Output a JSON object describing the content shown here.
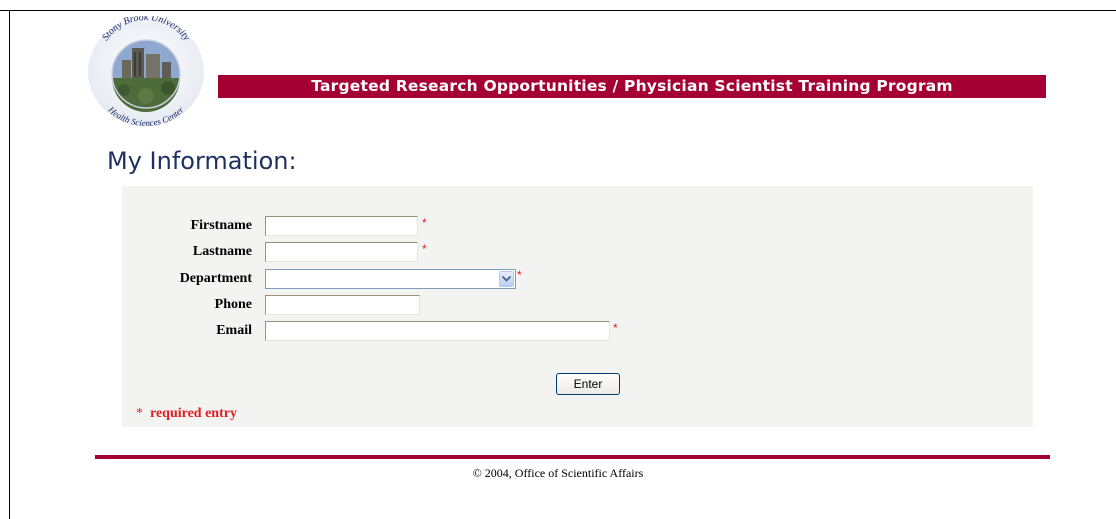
{
  "header": {
    "logo": {
      "top_text": "Stony Brook University",
      "bottom_text": "Health Sciences Center"
    },
    "banner_title": "Targeted Research Opportunities / Physician Scientist Training Program"
  },
  "page_title": "My Information:",
  "form": {
    "fields": [
      {
        "label": "Firstname",
        "value": "",
        "required": true
      },
      {
        "label": "Lastname",
        "value": "",
        "required": true
      },
      {
        "label": "Department",
        "value": "",
        "required": true
      },
      {
        "label": "Phone",
        "value": "",
        "required": false
      },
      {
        "label": "Email",
        "value": "",
        "required": true
      }
    ],
    "required_marker": "*",
    "submit_label": "Enter",
    "required_note": "required entry"
  },
  "footer": {
    "text": "© 2004, Office of Scientific Affairs"
  },
  "colors": {
    "brand": "#a50034",
    "title": "#1f2f5f",
    "required": "#e02020",
    "panel_bg": "#f3f3f2"
  }
}
